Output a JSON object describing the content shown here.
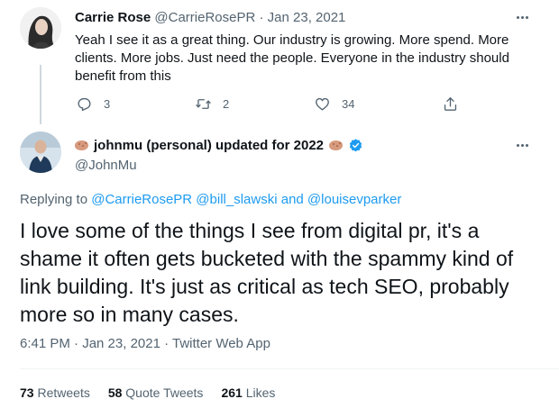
{
  "reply_tweet": {
    "name": "Carrie Rose",
    "handle": "@CarrieRosePR",
    "separator": "·",
    "date": "Jan 23, 2021",
    "text": "Yeah I see it as a great thing. Our industry is growing. More spend. More clients. More jobs. Just need the people. Everyone in the industry should benefit from this",
    "actions": {
      "reply_count": "3",
      "retweet_count": "2",
      "like_count": "34"
    }
  },
  "main_tweet": {
    "name": "johnmu (personal) updated for 2022",
    "handle": "@JohnMu",
    "replying_prefix": "Replying to",
    "replying_to": "@CarrieRosePR @bill_slawski and @louisevparker",
    "text": "I love some of the things I see from digital pr, it's a shame it often gets bucketed with the spammy kind of link building. It's just as critical as tech SEO, probably more so in many cases.",
    "timestamp": "6:41 PM · Jan 23, 2021 · Twitter Web App",
    "stats": {
      "retweets_count": "73",
      "retweets_label": "Retweets",
      "quotes_count": "58",
      "quotes_label": "Quote Tweets",
      "likes_count": "261",
      "likes_label": "Likes"
    }
  },
  "icons": {
    "reply": "reply-icon",
    "retweet": "retweet-icon",
    "like": "heart-icon",
    "share": "share-icon",
    "more": "more-icon",
    "verified": "verified-badge-icon",
    "emoji": "potato-emoji-icon"
  },
  "colors": {
    "link": "#1d9bf0",
    "muted": "#536471",
    "text": "#0f1419"
  }
}
